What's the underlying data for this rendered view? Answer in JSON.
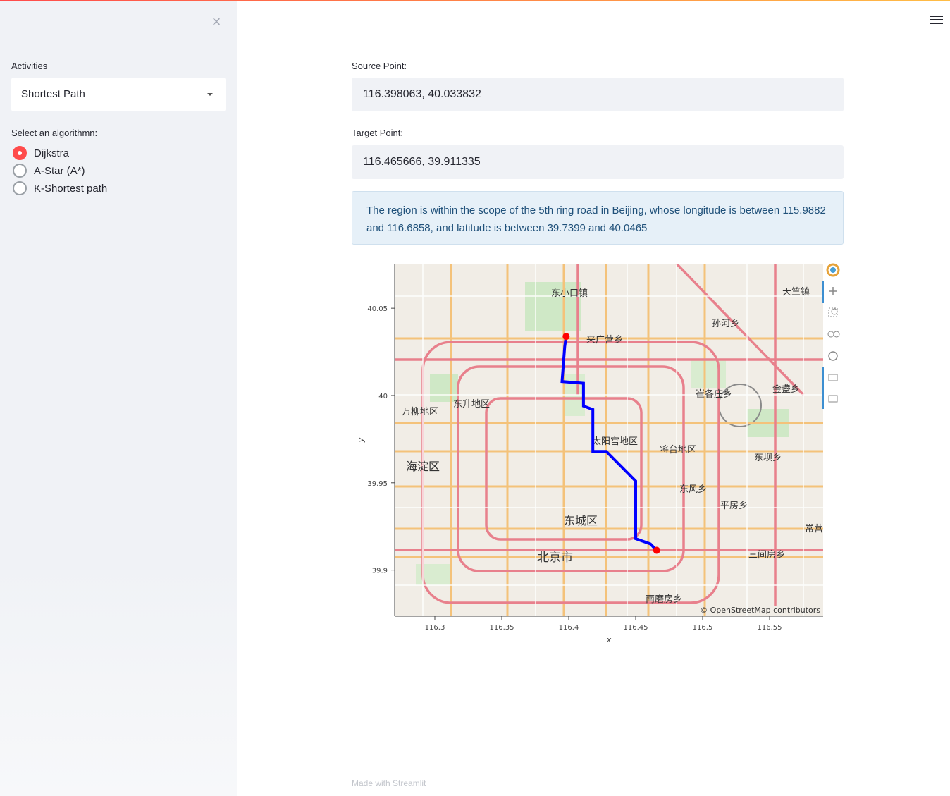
{
  "sidebar": {
    "activities_label": "Activities",
    "activities_value": "Shortest Path",
    "algorithm_label": "Select an algorithmn:",
    "algorithms": [
      {
        "label": "Dijkstra",
        "selected": true
      },
      {
        "label": "A-Star (A*)",
        "selected": false
      },
      {
        "label": "K-Shortest path",
        "selected": false
      }
    ]
  },
  "main": {
    "source_label": "Source Point:",
    "source_value": "116.398063, 40.033832",
    "target_label": "Target Point:",
    "target_value": "116.465666, 39.911335",
    "info_text": "The region is within the scope of the 5th ring road in Beijing, whose longitude is between 115.9882 and 116.6858, and latitude is between 39.7399 and 40.0465"
  },
  "map": {
    "attribution": "© OpenStreetMap contributors",
    "xlabel": "x",
    "ylabel": "y",
    "xticks": [
      "116.3",
      "116.35",
      "116.4",
      "116.45",
      "116.5",
      "116.55"
    ],
    "yticks": [
      "40.05",
      "40",
      "39.95",
      "39.9"
    ],
    "places": [
      "东小口镇",
      "天竺镇",
      "孙河乡",
      "来广营乡",
      "崔各庄乡",
      "金盏乡",
      "东升地区",
      "万柳地区",
      "太阳宫地区",
      "将台地区",
      "海淀区",
      "东坝乡",
      "东风乡",
      "平房乡",
      "东城区",
      "常营",
      "北京市",
      "三间房乡",
      "南磨房乡"
    ],
    "source_point": {
      "x": 116.398063,
      "y": 40.033832
    },
    "target_point": {
      "x": 116.465666,
      "y": 39.911335
    },
    "route_color": "#0000ff",
    "marker_color": "#ff0000",
    "toolbar_icons": [
      "bokeh-logo-icon",
      "pan-icon",
      "box-zoom-icon",
      "wheel-zoom-icon",
      "reset-icon",
      "hover-icon",
      "hover-icon"
    ]
  },
  "footer": "Made with Streamlit"
}
